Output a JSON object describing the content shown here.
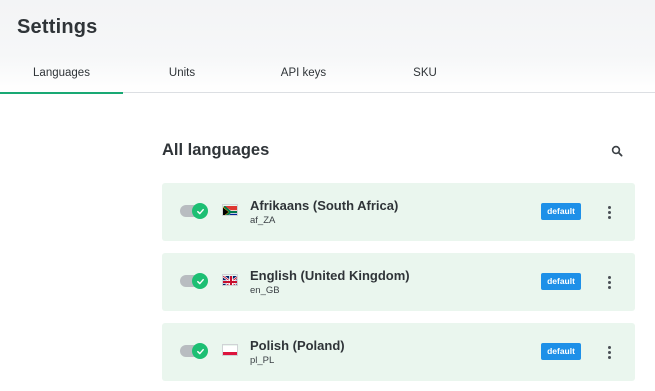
{
  "header": {
    "title": "Settings",
    "tabs": [
      {
        "label": "Languages",
        "active": true
      },
      {
        "label": "Units",
        "active": false
      },
      {
        "label": "API keys",
        "active": false
      },
      {
        "label": "SKU",
        "active": false
      }
    ]
  },
  "main": {
    "section_title": "All languages",
    "search_icon": "search-icon",
    "languages": [
      {
        "name": "Afrikaans (South Africa)",
        "code": "af_ZA",
        "enabled": true,
        "badge": "default",
        "flag": "south-africa-flag"
      },
      {
        "name": "English (United Kingdom)",
        "code": "en_GB",
        "enabled": true,
        "badge": "default",
        "flag": "united-kingdom-flag"
      },
      {
        "name": "Polish (Poland)",
        "code": "pl_PL",
        "enabled": true,
        "badge": "default",
        "flag": "poland-flag"
      }
    ]
  },
  "colors": {
    "accent_green": "#19a974",
    "card_background": "#eaf6ee",
    "badge_blue": "#1e90e8",
    "toggle_on": "#1dbf73"
  }
}
